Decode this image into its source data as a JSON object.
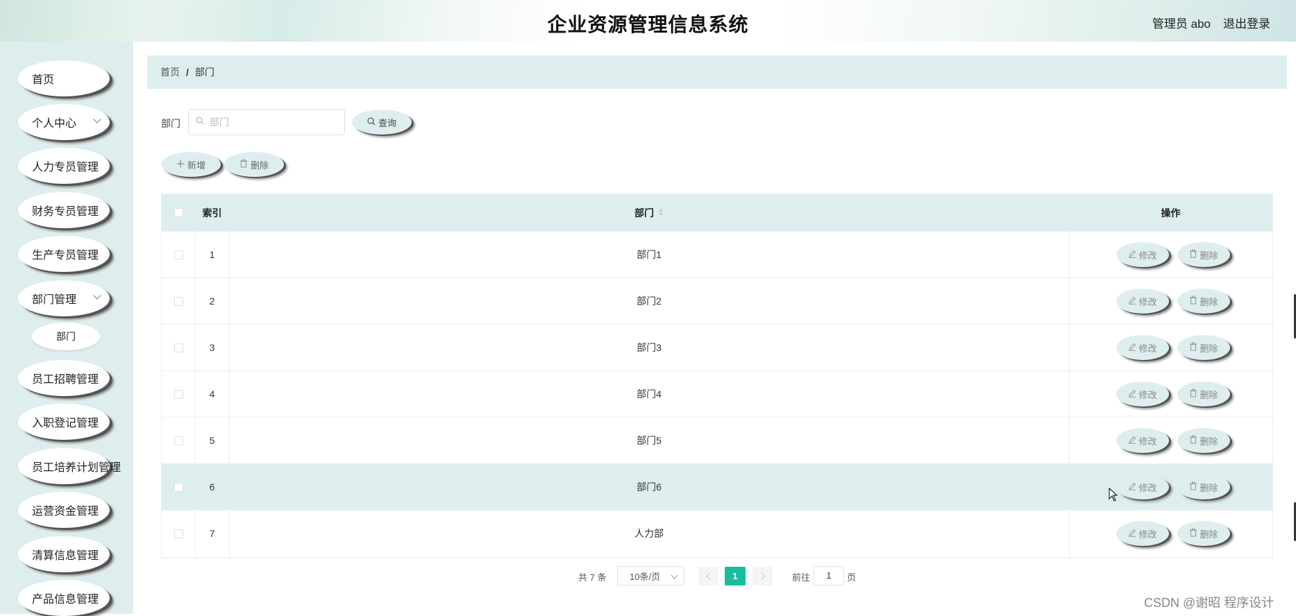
{
  "header": {
    "title": "企业资源管理信息系统",
    "user": "管理员 abo",
    "logout": "退出登录"
  },
  "sidebar": {
    "items": [
      {
        "label": "首页",
        "has_arrow": false
      },
      {
        "label": "个人中心",
        "has_arrow": true
      },
      {
        "label": "人力专员管理",
        "has_arrow": false
      },
      {
        "label": "财务专员管理",
        "has_arrow": false
      },
      {
        "label": "生产专员管理",
        "has_arrow": false
      },
      {
        "label": "部门管理",
        "has_arrow": true
      },
      {
        "label": "员工招聘管理",
        "has_arrow": false
      },
      {
        "label": "入职登记管理",
        "has_arrow": false
      },
      {
        "label": "员工培养计划管理",
        "has_arrow": false
      },
      {
        "label": "运营资金管理",
        "has_arrow": false
      },
      {
        "label": "清算信息管理",
        "has_arrow": false
      },
      {
        "label": "产品信息管理",
        "has_arrow": false
      }
    ],
    "submenu": {
      "label": "部门"
    }
  },
  "breadcrumb": {
    "home": "首页",
    "separator": "/",
    "current": "部门"
  },
  "search": {
    "label": "部门",
    "placeholder": "部门",
    "value": "",
    "button": "查询"
  },
  "actions": {
    "add": "新增",
    "delete": "删除"
  },
  "table": {
    "columns": {
      "index": "索引",
      "department": "部门",
      "operation": "操作"
    },
    "rows": [
      {
        "index": "1",
        "department": "部门1"
      },
      {
        "index": "2",
        "department": "部门2"
      },
      {
        "index": "3",
        "department": "部门3"
      },
      {
        "index": "4",
        "department": "部门4"
      },
      {
        "index": "5",
        "department": "部门5"
      },
      {
        "index": "6",
        "department": "部门6"
      },
      {
        "index": "7",
        "department": "人力部"
      }
    ],
    "edit_label": "修改",
    "delete_label": "删除",
    "highlight_row": 6
  },
  "pagination": {
    "total": "共 7 条",
    "page_size": "10条/页",
    "current_page": "1",
    "goto_label": "前往",
    "goto_value": "1",
    "page_unit": "页"
  },
  "watermark": "CSDN @谢昭  程序设计",
  "colors": {
    "accent": "#1abc9c",
    "panel": "#deeeee"
  }
}
